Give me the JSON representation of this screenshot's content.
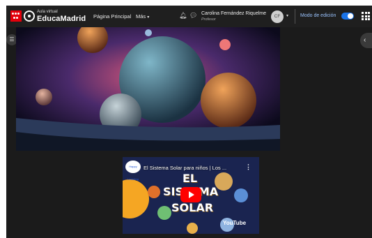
{
  "brand": {
    "small": "Aula virtual",
    "name": "EducaMadrid"
  },
  "nav": {
    "home": "Página Principal",
    "more": "Más"
  },
  "user": {
    "name": "Carolina Fernández Riquelme",
    "role": "Profesor",
    "initials": "CF"
  },
  "edit_mode": {
    "label": "Modo de edición",
    "on": true
  },
  "video": {
    "title": "El Sistema Solar para niños | Los ...",
    "overlay_line1": "EL",
    "overlay_line2": "SISTEMA",
    "overlay_line3": "SOLAR",
    "brand": "YouTube",
    "channel_logo": "Happy Learning"
  },
  "colors": {
    "navbar": "#1f1f1f",
    "accent": "#1a73e8",
    "flag": "#e3000b",
    "content_bg": "#1b1b1b"
  }
}
